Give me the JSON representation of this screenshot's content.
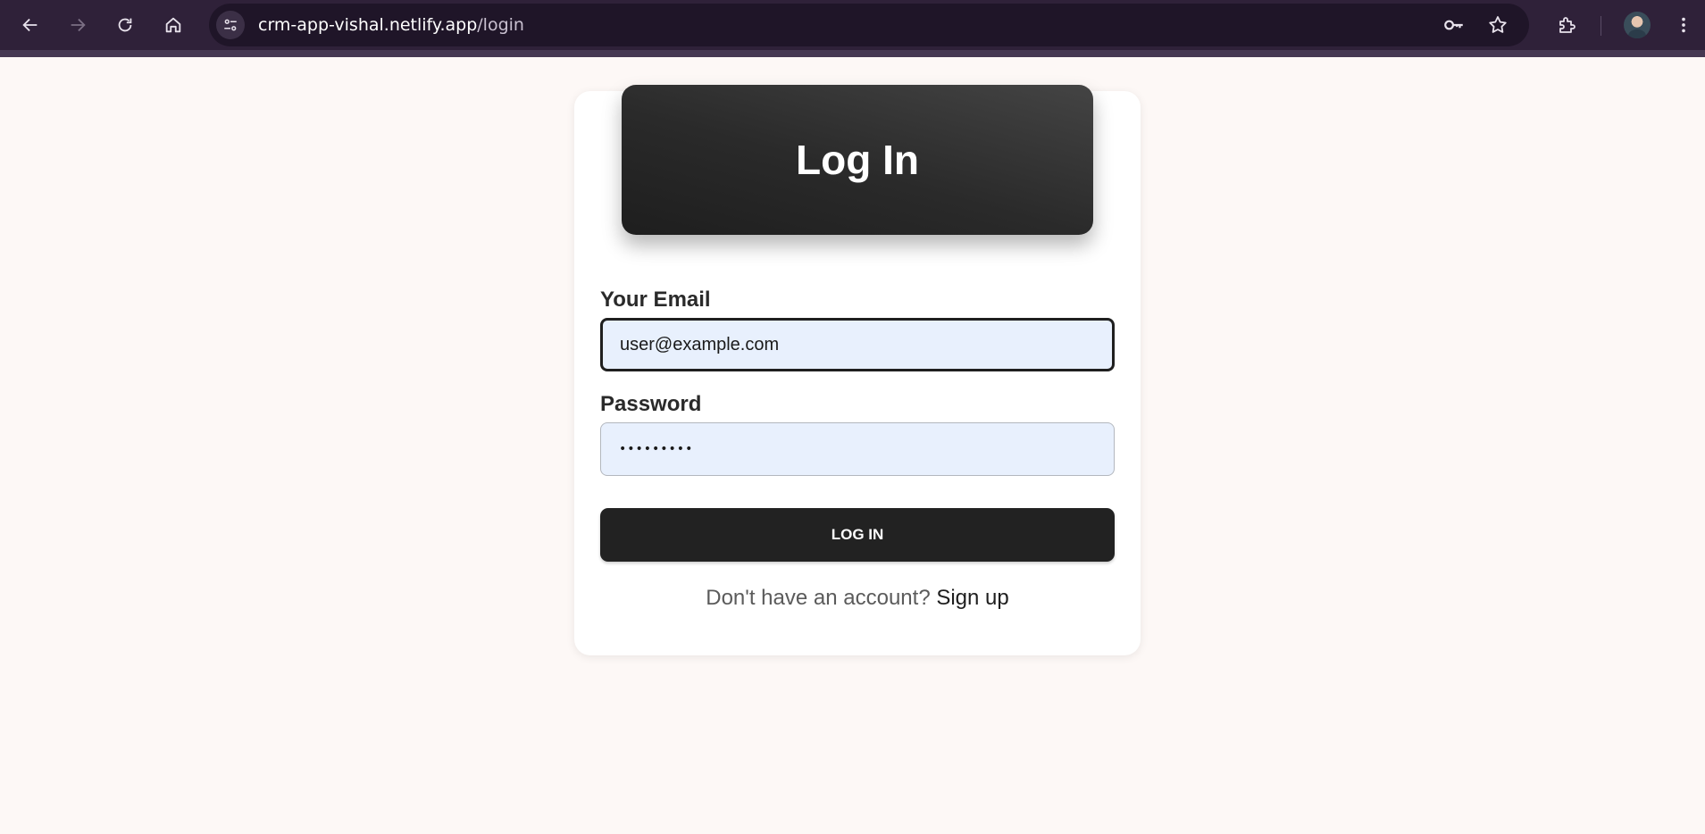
{
  "browser": {
    "url_host": "crm-app-vishal.netlify.app",
    "url_path": "/login",
    "icons": {
      "back": "arrow-left-icon",
      "forward": "arrow-right-icon",
      "reload": "reload-icon",
      "home": "home-icon",
      "site_info": "tune-icon",
      "password_manager": "key-icon",
      "bookmark": "star-icon",
      "extensions": "puzzle-icon",
      "menu": "kebab-menu-icon"
    },
    "colors": {
      "toolbar": "#2f2139",
      "omnibox": "#1f1528"
    }
  },
  "page": {
    "title": "Log In",
    "email": {
      "label": "Your Email",
      "value": "user@example.com"
    },
    "password": {
      "label": "Password",
      "value": "•••••••••"
    },
    "submit_label": "LOG IN",
    "signup": {
      "prompt": "Don't have an account?",
      "link_label": "Sign up"
    },
    "colors": {
      "background": "#fdf8f6",
      "card": "#ffffff",
      "header": "#2a2a2a",
      "input_fill": "#e8f0fd",
      "button": "#222222"
    }
  }
}
